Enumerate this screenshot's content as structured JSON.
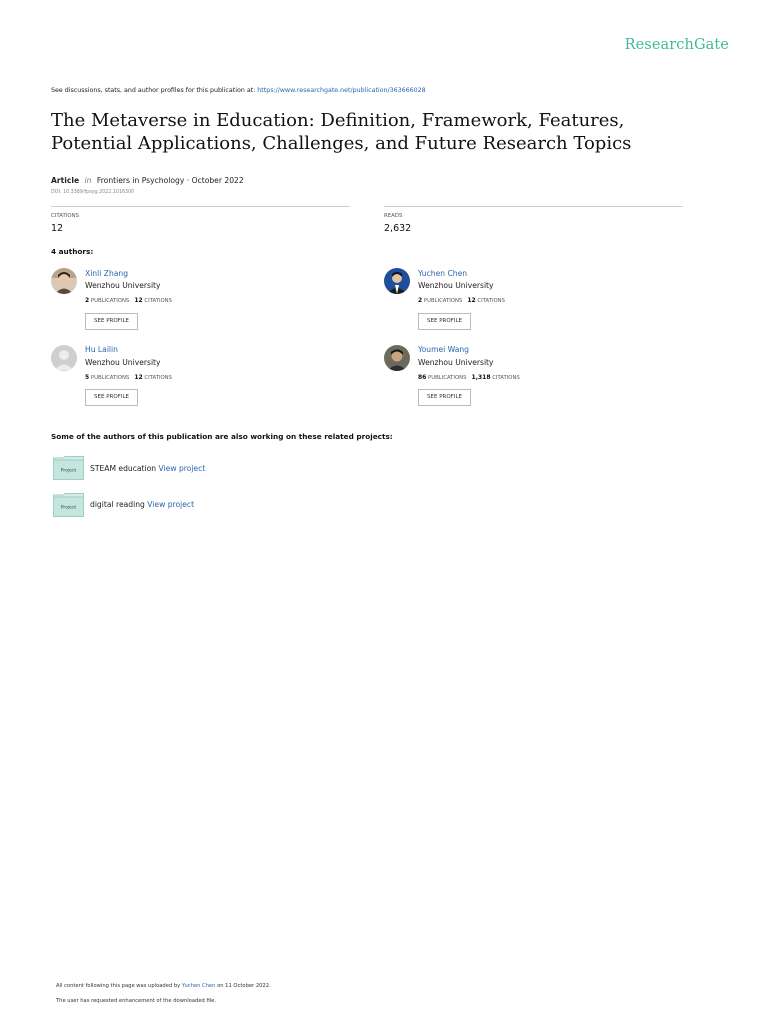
{
  "logo": "ResearchGate",
  "intro": {
    "prefix": "See discussions, stats, and author profiles for this publication at:",
    "url": "https://www.researchgate.net/publication/363666028"
  },
  "title": "The Metaverse in Education: Definition, Framework, Features, Potential Applications, Challenges, and Future Research Topics",
  "article": {
    "type": "Article",
    "in": "in",
    "venue": "Frontiers in Psychology · October 2022",
    "doi": "DOI: 10.3389/fpsyg.2022.1016300"
  },
  "stats": {
    "citations_label": "CITATIONS",
    "citations": "12",
    "reads_label": "READS",
    "reads": "2,632"
  },
  "authors_label": "4 authors:",
  "authors": [
    {
      "name": "Xinli Zhang",
      "institution": "Wenzhou University",
      "publications": "2",
      "publications_label": "PUBLICATIONS",
      "citations": "12",
      "citations_label": "CITATIONS",
      "button": "SEE PROFILE"
    },
    {
      "name": "Yuchen Chen",
      "institution": "Wenzhou University",
      "publications": "2",
      "publications_label": "PUBLICATIONS",
      "citations": "12",
      "citations_label": "CITATIONS",
      "button": "SEE PROFILE"
    },
    {
      "name": "Hu Lailin",
      "institution": "Wenzhou University",
      "publications": "5",
      "publications_label": "PUBLICATIONS",
      "citations": "12",
      "citations_label": "CITATIONS",
      "button": "SEE PROFILE"
    },
    {
      "name": "Youmei Wang",
      "institution": "Wenzhou University",
      "publications": "86",
      "publications_label": "PUBLICATIONS",
      "citations": "1,318",
      "citations_label": "CITATIONS",
      "button": "SEE PROFILE"
    }
  ],
  "projects_label": "Some of the authors of this publication are also working on these related projects:",
  "projects": [
    {
      "icon_label": "Project",
      "name": "STEAM education",
      "link": "View project"
    },
    {
      "icon_label": "Project",
      "name": "digital reading",
      "link": "View project"
    }
  ],
  "footer": {
    "uploaded_prefix": "All content following this page was uploaded by",
    "uploader": "Yuchen Chen",
    "uploaded_suffix": "on 11 October 2022.",
    "note": "The user has requested enhancement of the downloaded file."
  },
  "colors": {
    "accent": "#40ba9b",
    "link": "#2a65b0"
  }
}
